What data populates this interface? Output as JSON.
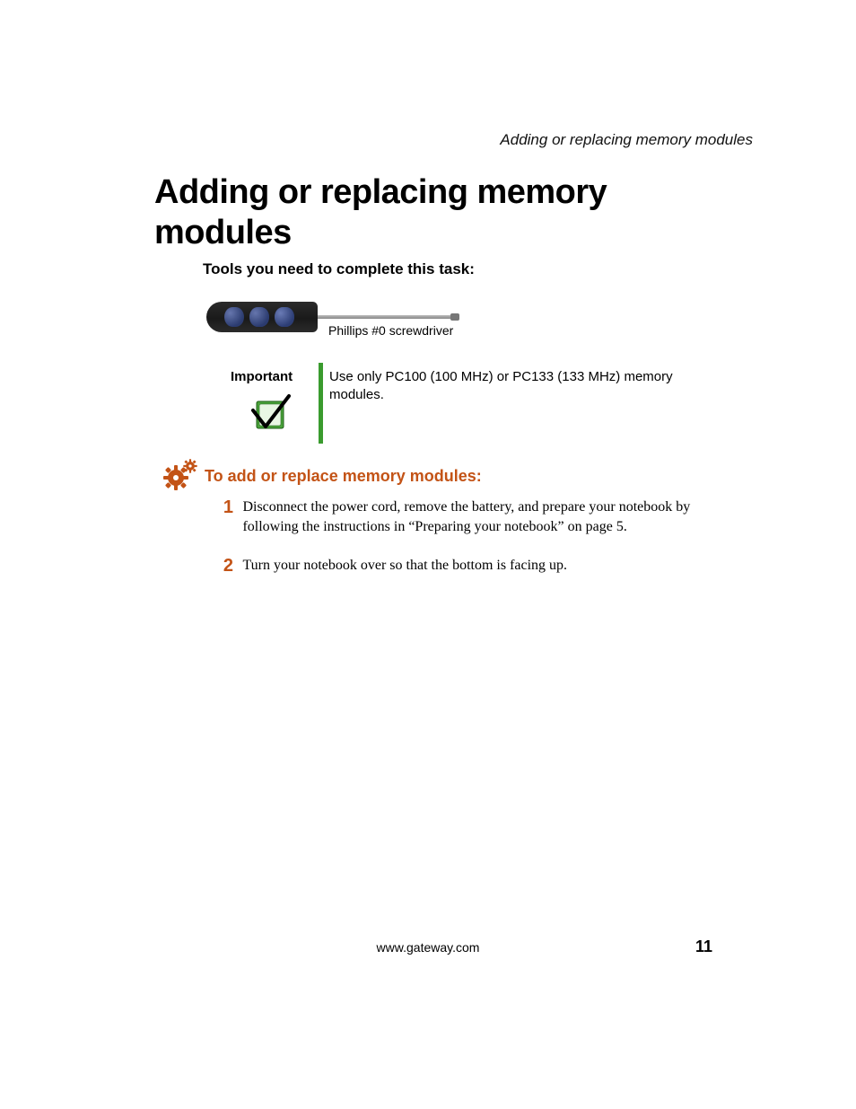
{
  "running_header": "Adding or replacing memory modules",
  "title": "Adding or replacing memory modules",
  "tools_heading": "Tools you need to complete this task:",
  "tool_label": "Phillips #0 screwdriver",
  "important": {
    "label": "Important",
    "text": "Use only PC100 (100 MHz) or PC133 (133 MHz) memory modules."
  },
  "procedure_heading": "To add or replace memory modules:",
  "steps": [
    {
      "num": "1",
      "text": "Disconnect the power cord, remove the battery, and prepare your notebook by following the instructions in “Preparing your notebook” on page 5."
    },
    {
      "num": "2",
      "text": "Turn your notebook over so that the bottom is facing up."
    }
  ],
  "footer": {
    "url": "www.gateway.com",
    "page": "11"
  }
}
